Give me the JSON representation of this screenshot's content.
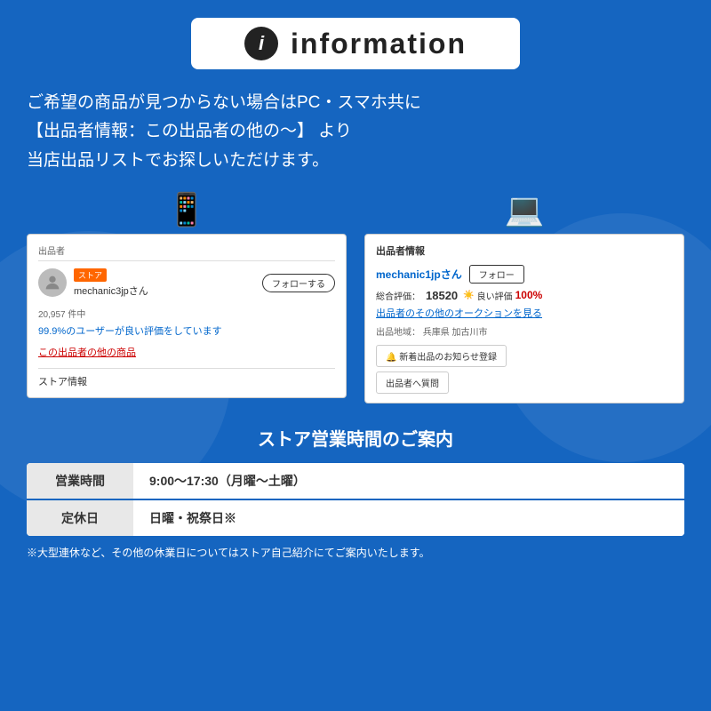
{
  "header": {
    "icon_text": "i",
    "title": "information"
  },
  "description": {
    "line1": "ご希望の商品が見つからない場合はPC・スマホ共に",
    "line2": "【出品者情報：この出品者の他の〜】 より",
    "line3": "当店出品リストでお探しいただけます。"
  },
  "left_screenshot": {
    "label": "出品者",
    "store_badge": "ストア",
    "seller_name": "mechanic3jpさん",
    "follow_btn": "フォローする",
    "stats": "20,957 件中",
    "stats_blue": "99.9%のユーザーが良い評価をしています",
    "other_items": "この出品者の他の商品",
    "store_info": "ストア情報"
  },
  "right_screenshot": {
    "label": "出品者情報",
    "seller_name": "mechanic1jpさん",
    "follow_btn": "フォロー",
    "rating_label": "総合評価：",
    "rating_num": "18520",
    "good_label": "良い評価",
    "good_pct": "100%",
    "auction_link": "出品者のその他のオークションを見る",
    "location_label": "出品地域：",
    "location": "兵庫県 加古川市",
    "notify_btn": "🔔 新着出品のお知らせ登録",
    "question_btn": "出品者へ質問"
  },
  "business": {
    "title": "ストア営業時間のご案内",
    "row1_label": "営業時間",
    "row1_value": "9:00〜17:30（月曜〜土曜）",
    "row2_label": "定休日",
    "row2_value": "日曜・祝祭日※"
  },
  "note": "※大型連休など、その他の休業日についてはストア自己紹介にてご案内いたします。"
}
